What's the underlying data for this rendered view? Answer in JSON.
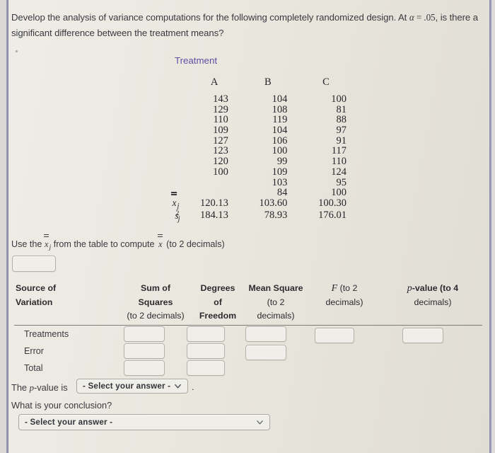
{
  "prompt": {
    "line1_a": "Develop the analysis of variance computations for the following completely randomized design. At ",
    "line1_alpha": "α",
    "line1_eq": " = .05",
    "line1_b": ", is",
    "line2": "there a significant difference between the treatment means?"
  },
  "data_table": {
    "title": "Treatment",
    "columns": [
      "A",
      "B",
      "C"
    ],
    "rows": [
      [
        "143",
        "104",
        "100"
      ],
      [
        "129",
        "108",
        "81"
      ],
      [
        "110",
        "119",
        "88"
      ],
      [
        "109",
        "104",
        "97"
      ],
      [
        "127",
        "106",
        "91"
      ],
      [
        "123",
        "100",
        "117"
      ],
      [
        "120",
        "99",
        "110"
      ],
      [
        "100",
        "109",
        "124"
      ],
      [
        "",
        "103",
        "95"
      ],
      [
        "",
        "84",
        "100"
      ]
    ],
    "mean_label": "x",
    "mean_sub": "j",
    "means": [
      "120.13",
      "103.60",
      "100.30"
    ],
    "var_label": "s",
    "var_sub": "j",
    "var_sup": "2",
    "variances": [
      "184.13",
      "78.93",
      "176.01"
    ]
  },
  "grand_mean": {
    "text_before": "Use the ",
    "xbar_j": "x",
    "xbar_j_sub": "j",
    "text_mid": " from the table to compute ",
    "xdblbar": "x",
    "text_after": " (to 2 decimals)",
    "input_value": ""
  },
  "anova": {
    "headers": {
      "source": [
        "Source of",
        "Variation"
      ],
      "sum_of_squares": [
        "Sum of",
        "Squares",
        "(to 2 decimals)"
      ],
      "degrees_of_freedom": [
        "Degrees",
        "of",
        "Freedom"
      ],
      "mean_square": [
        "Mean Square",
        "(to 2",
        "decimals)"
      ],
      "f": [
        "F",
        " (to 2",
        "decimals)"
      ],
      "p_value": [
        "p",
        "-value (to 4",
        "decimals)"
      ]
    },
    "rows": [
      {
        "label": "Treatments",
        "ss": "",
        "df": "",
        "ms": "",
        "f": "",
        "p": ""
      },
      {
        "label": "Error",
        "ss": "",
        "df": "",
        "ms": ""
      },
      {
        "label": "Total",
        "ss": "",
        "df": ""
      }
    ]
  },
  "conclusion": {
    "pvalue_text_before": "The ",
    "pvalue_italic": "p",
    "pvalue_text_after": "-value is",
    "pvalue_select": "- Select your answer -",
    "period": ".",
    "question": "What is your conclusion?",
    "conclusion_select": "- Select your answer -"
  },
  "colors": {
    "page_background": "#e8e5dc",
    "treatment_heading": "#5b4fa4",
    "text": "#3a3a40",
    "input_border": "#b3b1aa",
    "rule": "#7d7c78",
    "edge_rule": "#8081ab"
  }
}
